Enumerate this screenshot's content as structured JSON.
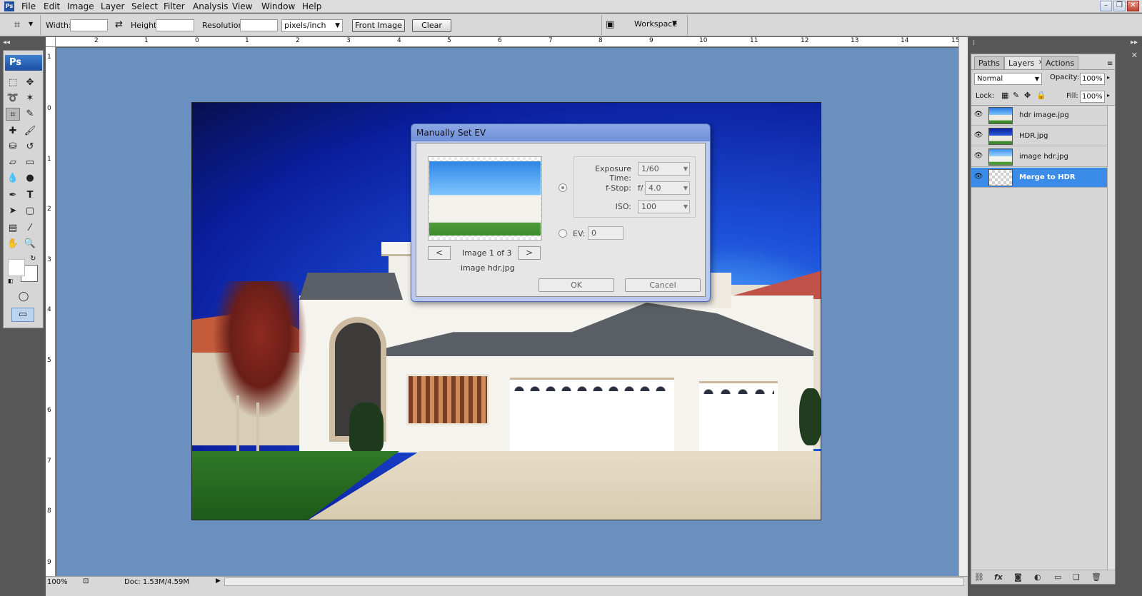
{
  "app": {
    "logo": "Ps"
  },
  "menu": [
    "File",
    "Edit",
    "Image",
    "Layer",
    "Select",
    "Filter",
    "Analysis",
    "View",
    "Window",
    "Help"
  ],
  "window_controls": {
    "minimize": "–",
    "restore": "❐",
    "close": "✕"
  },
  "options": {
    "width_label": "Width:",
    "height_label": "Height:",
    "resolution_label": "Resolution:",
    "unit": "pixels/inch",
    "front_image": "Front Image",
    "clear": "Clear",
    "workspace": "Workspace"
  },
  "tools": {
    "badge": "Ps"
  },
  "ruler": {
    "top": [
      "2",
      "1",
      "0",
      "1",
      "2",
      "3",
      "4",
      "5",
      "6",
      "7",
      "8",
      "9",
      "10",
      "11",
      "12",
      "13",
      "14",
      "15"
    ],
    "left": [
      "1",
      "0",
      "1",
      "2",
      "3",
      "4",
      "5",
      "6",
      "7",
      "8",
      "9"
    ]
  },
  "status": {
    "zoom": "100%",
    "doc": "Doc: 1.53M/4.59M"
  },
  "dialog": {
    "title": "Manually Set EV",
    "exposure_label": "Exposure Time:",
    "exposure_value": "1/60",
    "fstop_label": "f-Stop:",
    "fstop_prefix": "f/",
    "fstop_value": "4.0",
    "iso_label": "ISO:",
    "iso_value": "100",
    "ev_label": "EV:",
    "ev_value": "0",
    "prev": "<",
    "next": ">",
    "counter": "Image 1 of 3",
    "filename": "image hdr.jpg",
    "ok": "OK",
    "cancel": "Cancel"
  },
  "panel": {
    "tabs": [
      "Paths",
      "Layers",
      "Actions"
    ],
    "blend_mode": "Normal",
    "opacity_label": "Opacity:",
    "opacity_value": "100%",
    "lock_label": "Lock:",
    "fill_label": "Fill:",
    "fill_value": "100%",
    "layers": [
      {
        "name": "hdr image.jpg",
        "selected": false
      },
      {
        "name": "HDR.jpg",
        "selected": false
      },
      {
        "name": "image hdr.jpg",
        "selected": false
      },
      {
        "name": "Merge to HDR",
        "selected": true
      }
    ],
    "footer_icons": [
      "link-icon",
      "fx-icon",
      "mask-icon",
      "adjustment-icon",
      "group-icon",
      "new-layer-icon",
      "trash-icon"
    ]
  }
}
